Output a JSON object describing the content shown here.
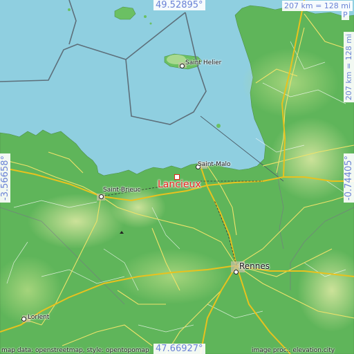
{
  "map": {
    "highlight_label": "Lancieux",
    "coords": {
      "top": "49.52895°",
      "bottom": "47.66927°",
      "left": "-3.56658°",
      "right": "-0.74405°"
    },
    "scale": {
      "horizontal": "207 km = 128 mi",
      "vertical": "207 km = 128 mi"
    },
    "cities": [
      {
        "name": "Saint Helier",
        "key": "saint-helier"
      },
      {
        "name": "Saint-Malo",
        "key": "saint-malo"
      },
      {
        "name": "Saint-Brieuc",
        "key": "saint-brieuc"
      },
      {
        "name": "Rennes",
        "key": "rennes"
      },
      {
        "name": "Lorient",
        "key": "lorient"
      }
    ],
    "attribution_left": "map data: openstreetmap, style: opentopomap",
    "attribution_right": "image proc.: elevation.city",
    "corner_mark": "P",
    "colors": {
      "sea": "#8fcfe0",
      "land": "#5fb55a",
      "land_light": "#9fd27a",
      "roads": "#f0e04a",
      "label_blue": "#6a82d6",
      "highlight": "#e8241c"
    }
  }
}
